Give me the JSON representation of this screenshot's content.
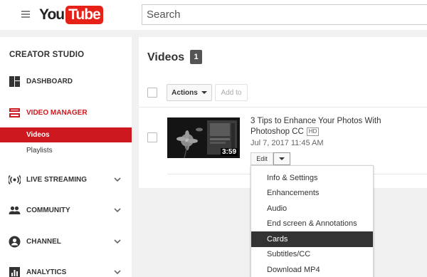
{
  "header": {
    "logo_you": "You",
    "logo_tube": "Tube",
    "search_placeholder": "Search"
  },
  "sidebar": {
    "title": "CREATOR STUDIO",
    "items": [
      {
        "label": "DASHBOARD",
        "icon": "dashboard-icon"
      },
      {
        "label": "VIDEO MANAGER",
        "icon": "video-manager-icon",
        "active": true
      },
      {
        "label": "LIVE STREAMING",
        "icon": "live-streaming-icon"
      },
      {
        "label": "COMMUNITY",
        "icon": "community-icon"
      },
      {
        "label": "CHANNEL",
        "icon": "channel-icon"
      },
      {
        "label": "ANALYTICS",
        "icon": "analytics-icon"
      }
    ],
    "sub_items": [
      {
        "label": "Videos",
        "active": true
      },
      {
        "label": "Playlists"
      }
    ]
  },
  "main": {
    "title": "Videos",
    "count": "1",
    "actions_label": "Actions",
    "add_to_label": "Add to",
    "video": {
      "title": "3 Tips to Enhance Your Photos With Photoshop CC",
      "hd_badge": "HD",
      "date": "Jul 7, 2017 11:45 AM",
      "duration": "3:59",
      "edit_label": "Edit"
    }
  },
  "menu": {
    "items": [
      "Info & Settings",
      "Enhancements",
      "Audio",
      "End screen & Annotations",
      "Cards",
      "Subtitles/CC",
      "Download MP4"
    ],
    "highlighted": "Cards"
  },
  "colors": {
    "brand_red": "#cc181e",
    "logo_red": "#e62117",
    "highlight": "#333333"
  }
}
